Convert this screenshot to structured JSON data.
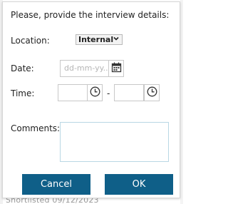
{
  "dialog": {
    "title": "Please, provide the interview details:",
    "location_label": "Location:",
    "location_value": "Internal",
    "date_label": "Date:",
    "date_placeholder": "dd-mm-yy...",
    "time_label": "Time:",
    "time_separator": "-",
    "comments_label": "Comments:",
    "cancel_label": "Cancel",
    "ok_label": "OK"
  },
  "background": {
    "partial_text": "Shortlisted    09/12/2023"
  },
  "colors": {
    "button_bg": "#0f5f88",
    "button_text": "#ffffff",
    "comments_border": "#b9d7e4"
  }
}
